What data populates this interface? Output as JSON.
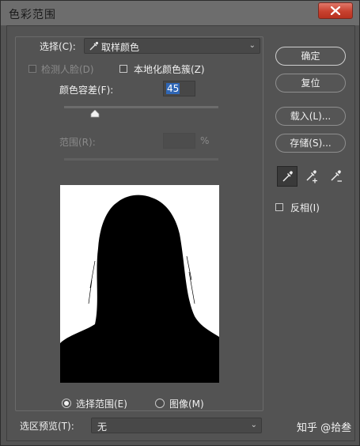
{
  "window": {
    "title": "色彩范围",
    "close_icon": "close-icon"
  },
  "select_row": {
    "label": "选择(C):",
    "value": "取样颜色",
    "icon": "eyedropper-icon"
  },
  "detect_faces": {
    "label": "检测人脸(D)",
    "checked": false,
    "enabled": false
  },
  "localized_clusters": {
    "label": "本地化颜色簇(Z)",
    "checked": false
  },
  "fuzziness": {
    "label": "颜色容差(F):",
    "value": "45",
    "level": 0.2
  },
  "range": {
    "label": "范围(R):",
    "value": "",
    "unit": "%",
    "enabled": false
  },
  "view_mode": {
    "options": [
      {
        "label": "选择范围(E)",
        "selected": true
      },
      {
        "label": "图像(M)",
        "selected": false
      }
    ]
  },
  "selection_preview": {
    "label": "选区预览(T):",
    "value": "无"
  },
  "buttons": {
    "ok": "确定",
    "reset": "复位",
    "load": "载入(L)...",
    "save": "存储(S)..."
  },
  "tools": [
    {
      "name": "eyedropper-icon",
      "active": true
    },
    {
      "name": "eyedropper-plus-icon",
      "active": false
    },
    {
      "name": "eyedropper-minus-icon",
      "active": false
    }
  ],
  "invert": {
    "label": "反相(I)",
    "checked": false
  },
  "watermark": "知乎 @拾叁",
  "colors": {
    "dialog_bg": "#535353",
    "titlebar": "#6d6d6d",
    "close_button": "#c8412f",
    "field_highlight": "#2f66b5"
  }
}
